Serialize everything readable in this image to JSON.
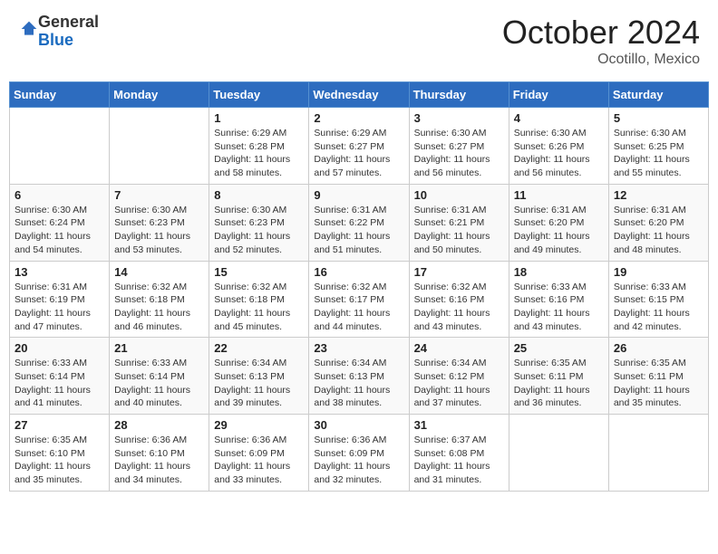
{
  "header": {
    "logo_general": "General",
    "logo_blue": "Blue",
    "month_title": "October 2024",
    "location": "Ocotillo, Mexico"
  },
  "days_of_week": [
    "Sunday",
    "Monday",
    "Tuesday",
    "Wednesday",
    "Thursday",
    "Friday",
    "Saturday"
  ],
  "weeks": [
    [
      {
        "day": "",
        "sunrise": "",
        "sunset": "",
        "daylight": ""
      },
      {
        "day": "",
        "sunrise": "",
        "sunset": "",
        "daylight": ""
      },
      {
        "day": "1",
        "sunrise": "Sunrise: 6:29 AM",
        "sunset": "Sunset: 6:28 PM",
        "daylight": "Daylight: 11 hours and 58 minutes."
      },
      {
        "day": "2",
        "sunrise": "Sunrise: 6:29 AM",
        "sunset": "Sunset: 6:27 PM",
        "daylight": "Daylight: 11 hours and 57 minutes."
      },
      {
        "day": "3",
        "sunrise": "Sunrise: 6:30 AM",
        "sunset": "Sunset: 6:27 PM",
        "daylight": "Daylight: 11 hours and 56 minutes."
      },
      {
        "day": "4",
        "sunrise": "Sunrise: 6:30 AM",
        "sunset": "Sunset: 6:26 PM",
        "daylight": "Daylight: 11 hours and 56 minutes."
      },
      {
        "day": "5",
        "sunrise": "Sunrise: 6:30 AM",
        "sunset": "Sunset: 6:25 PM",
        "daylight": "Daylight: 11 hours and 55 minutes."
      }
    ],
    [
      {
        "day": "6",
        "sunrise": "Sunrise: 6:30 AM",
        "sunset": "Sunset: 6:24 PM",
        "daylight": "Daylight: 11 hours and 54 minutes."
      },
      {
        "day": "7",
        "sunrise": "Sunrise: 6:30 AM",
        "sunset": "Sunset: 6:23 PM",
        "daylight": "Daylight: 11 hours and 53 minutes."
      },
      {
        "day": "8",
        "sunrise": "Sunrise: 6:30 AM",
        "sunset": "Sunset: 6:23 PM",
        "daylight": "Daylight: 11 hours and 52 minutes."
      },
      {
        "day": "9",
        "sunrise": "Sunrise: 6:31 AM",
        "sunset": "Sunset: 6:22 PM",
        "daylight": "Daylight: 11 hours and 51 minutes."
      },
      {
        "day": "10",
        "sunrise": "Sunrise: 6:31 AM",
        "sunset": "Sunset: 6:21 PM",
        "daylight": "Daylight: 11 hours and 50 minutes."
      },
      {
        "day": "11",
        "sunrise": "Sunrise: 6:31 AM",
        "sunset": "Sunset: 6:20 PM",
        "daylight": "Daylight: 11 hours and 49 minutes."
      },
      {
        "day": "12",
        "sunrise": "Sunrise: 6:31 AM",
        "sunset": "Sunset: 6:20 PM",
        "daylight": "Daylight: 11 hours and 48 minutes."
      }
    ],
    [
      {
        "day": "13",
        "sunrise": "Sunrise: 6:31 AM",
        "sunset": "Sunset: 6:19 PM",
        "daylight": "Daylight: 11 hours and 47 minutes."
      },
      {
        "day": "14",
        "sunrise": "Sunrise: 6:32 AM",
        "sunset": "Sunset: 6:18 PM",
        "daylight": "Daylight: 11 hours and 46 minutes."
      },
      {
        "day": "15",
        "sunrise": "Sunrise: 6:32 AM",
        "sunset": "Sunset: 6:18 PM",
        "daylight": "Daylight: 11 hours and 45 minutes."
      },
      {
        "day": "16",
        "sunrise": "Sunrise: 6:32 AM",
        "sunset": "Sunset: 6:17 PM",
        "daylight": "Daylight: 11 hours and 44 minutes."
      },
      {
        "day": "17",
        "sunrise": "Sunrise: 6:32 AM",
        "sunset": "Sunset: 6:16 PM",
        "daylight": "Daylight: 11 hours and 43 minutes."
      },
      {
        "day": "18",
        "sunrise": "Sunrise: 6:33 AM",
        "sunset": "Sunset: 6:16 PM",
        "daylight": "Daylight: 11 hours and 43 minutes."
      },
      {
        "day": "19",
        "sunrise": "Sunrise: 6:33 AM",
        "sunset": "Sunset: 6:15 PM",
        "daylight": "Daylight: 11 hours and 42 minutes."
      }
    ],
    [
      {
        "day": "20",
        "sunrise": "Sunrise: 6:33 AM",
        "sunset": "Sunset: 6:14 PM",
        "daylight": "Daylight: 11 hours and 41 minutes."
      },
      {
        "day": "21",
        "sunrise": "Sunrise: 6:33 AM",
        "sunset": "Sunset: 6:14 PM",
        "daylight": "Daylight: 11 hours and 40 minutes."
      },
      {
        "day": "22",
        "sunrise": "Sunrise: 6:34 AM",
        "sunset": "Sunset: 6:13 PM",
        "daylight": "Daylight: 11 hours and 39 minutes."
      },
      {
        "day": "23",
        "sunrise": "Sunrise: 6:34 AM",
        "sunset": "Sunset: 6:13 PM",
        "daylight": "Daylight: 11 hours and 38 minutes."
      },
      {
        "day": "24",
        "sunrise": "Sunrise: 6:34 AM",
        "sunset": "Sunset: 6:12 PM",
        "daylight": "Daylight: 11 hours and 37 minutes."
      },
      {
        "day": "25",
        "sunrise": "Sunrise: 6:35 AM",
        "sunset": "Sunset: 6:11 PM",
        "daylight": "Daylight: 11 hours and 36 minutes."
      },
      {
        "day": "26",
        "sunrise": "Sunrise: 6:35 AM",
        "sunset": "Sunset: 6:11 PM",
        "daylight": "Daylight: 11 hours and 35 minutes."
      }
    ],
    [
      {
        "day": "27",
        "sunrise": "Sunrise: 6:35 AM",
        "sunset": "Sunset: 6:10 PM",
        "daylight": "Daylight: 11 hours and 35 minutes."
      },
      {
        "day": "28",
        "sunrise": "Sunrise: 6:36 AM",
        "sunset": "Sunset: 6:10 PM",
        "daylight": "Daylight: 11 hours and 34 minutes."
      },
      {
        "day": "29",
        "sunrise": "Sunrise: 6:36 AM",
        "sunset": "Sunset: 6:09 PM",
        "daylight": "Daylight: 11 hours and 33 minutes."
      },
      {
        "day": "30",
        "sunrise": "Sunrise: 6:36 AM",
        "sunset": "Sunset: 6:09 PM",
        "daylight": "Daylight: 11 hours and 32 minutes."
      },
      {
        "day": "31",
        "sunrise": "Sunrise: 6:37 AM",
        "sunset": "Sunset: 6:08 PM",
        "daylight": "Daylight: 11 hours and 31 minutes."
      },
      {
        "day": "",
        "sunrise": "",
        "sunset": "",
        "daylight": ""
      },
      {
        "day": "",
        "sunrise": "",
        "sunset": "",
        "daylight": ""
      }
    ]
  ]
}
